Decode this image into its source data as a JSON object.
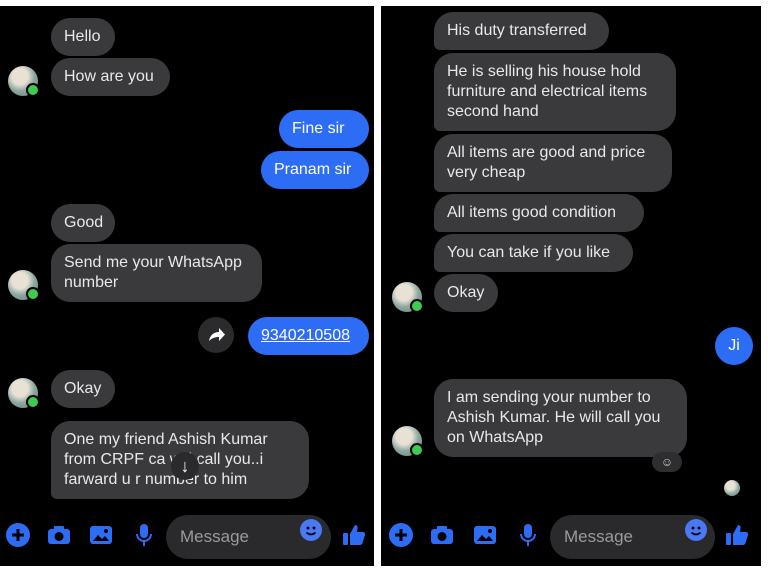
{
  "accent_color": "#2d6df5",
  "incoming_color": "#3a3a3c",
  "left": {
    "messages": {
      "m1": "Hello",
      "m2": "How are you",
      "m3": "Fine sir",
      "m4": "Pranam sir",
      "m5": "Good",
      "m6": "Send me your WhatsApp\nnumber",
      "m7": "9340210508",
      "m8": "Okay",
      "m9": "One my friend Ashish Kumar\nfrom CRPF ca   will call you..i\nfarward u r number to him"
    },
    "composer": {
      "placeholder": "Message"
    }
  },
  "right": {
    "messages": {
      "m1": "His duty transferred",
      "m2": "He is selling his house hold\nfurniture and electrical items\nsecond hand",
      "m3": "All items are good and price\nvery cheap",
      "m4": "All items good condition",
      "m5": "You can take if you like",
      "m6": "Okay",
      "m7": "Ji",
      "m8": "I am sending your number to\nAshish Kumar. He will call you\non WhatsApp"
    },
    "composer": {
      "placeholder": "Message"
    }
  },
  "icons": {
    "plus": "plus-icon",
    "camera": "camera-icon",
    "gallery": "image-icon",
    "mic": "microphone-icon",
    "emoji": "emoji-icon",
    "like": "thumbs-up-icon",
    "share": "share-arrow-icon",
    "scroll_down": "arrow-down-icon"
  }
}
